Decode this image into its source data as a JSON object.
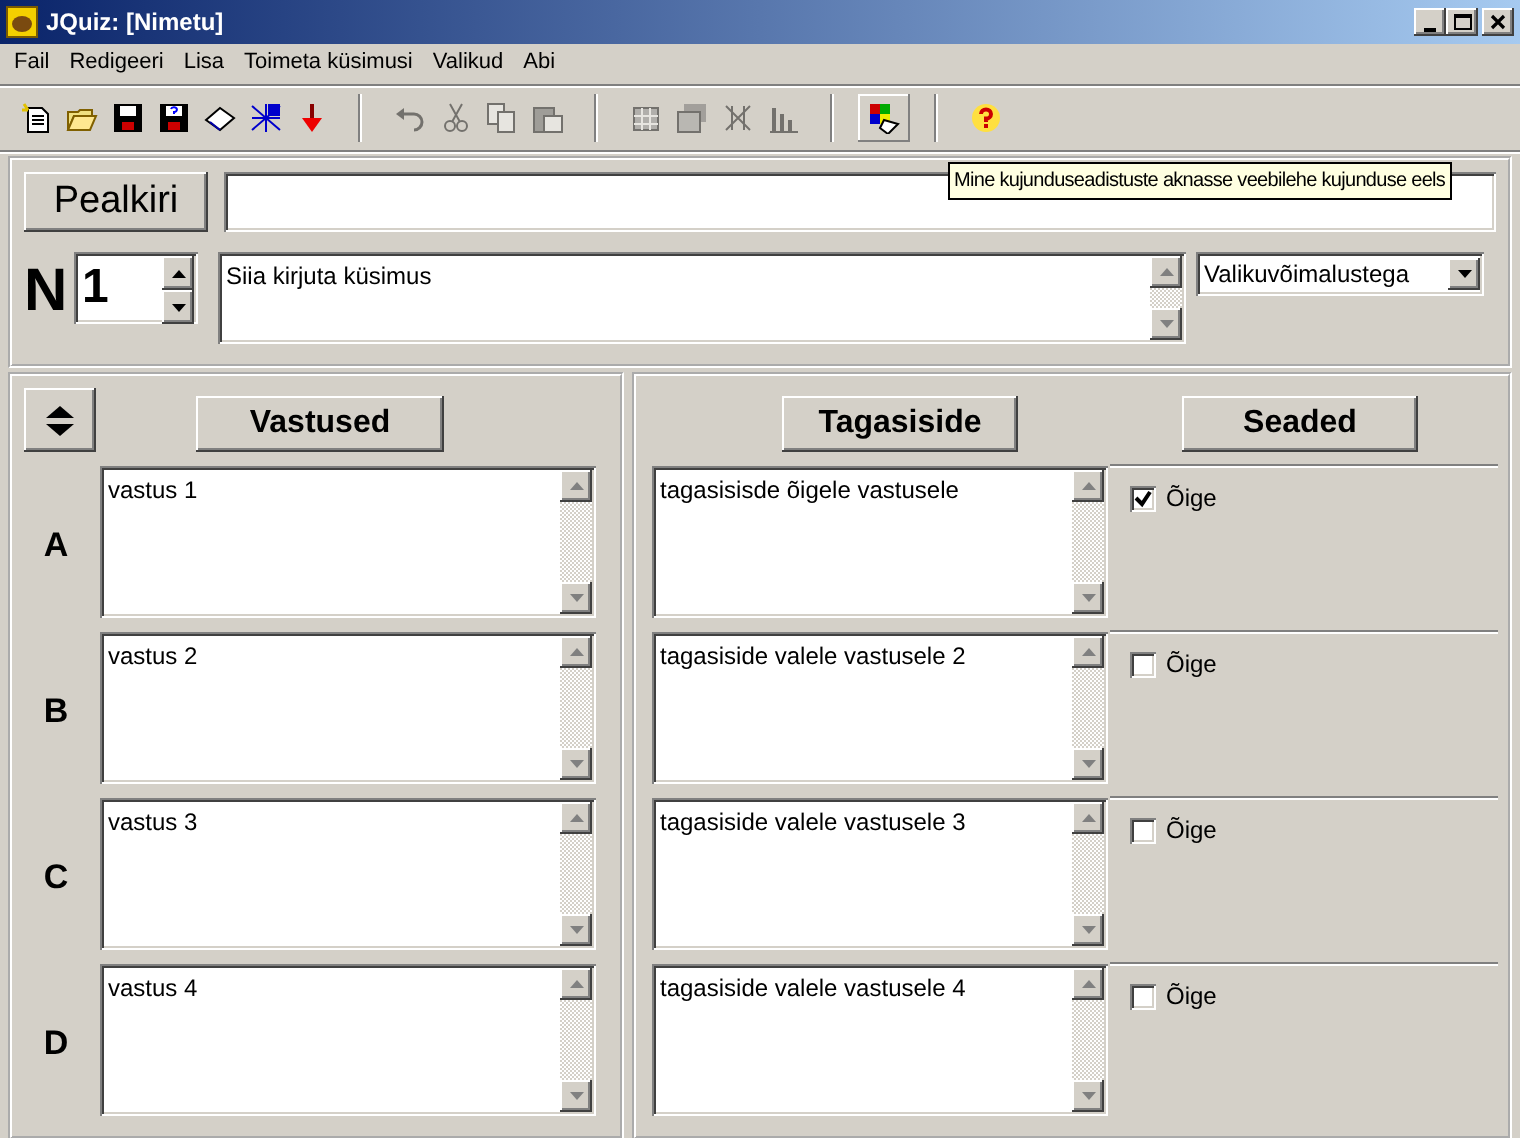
{
  "window": {
    "title": "JQuiz: [Nimetu]"
  },
  "menu": [
    "Fail",
    "Redigeeri",
    "Lisa",
    "Toimeta küsimusi",
    "Valikud",
    "Abi"
  ],
  "toolbar": [
    {
      "buttons": [
        {
          "disabled": false,
          "pressed": false
        },
        {
          "disabled": false,
          "pressed": false
        },
        {
          "disabled": false,
          "pressed": false
        },
        {
          "disabled": false,
          "pressed": false
        },
        {
          "disabled": false,
          "pressed": false
        },
        {
          "disabled": false,
          "pressed": false
        },
        {
          "disabled": false,
          "pressed": false
        }
      ]
    },
    {
      "buttons": [
        {
          "disabled": true,
          "pressed": false
        },
        {
          "disabled": true,
          "pressed": false
        },
        {
          "disabled": true,
          "pressed": false
        },
        {
          "disabled": true,
          "pressed": false
        }
      ]
    },
    {
      "buttons": [
        {
          "disabled": true,
          "pressed": false
        },
        {
          "disabled": true,
          "pressed": false
        },
        {
          "disabled": true,
          "pressed": false
        },
        {
          "disabled": true,
          "pressed": false
        }
      ]
    },
    {
      "buttons": [
        {
          "disabled": false,
          "pressed": true
        }
      ]
    },
    {
      "buttons": [
        {
          "disabled": false,
          "pressed": false
        }
      ]
    }
  ],
  "tooltip": "Mine kujunduseadistuste aknasse veebilehe kujunduse eels",
  "title_button": "Pealkiri",
  "question": {
    "number_label": "N",
    "number": "1",
    "text": "Siia kirjuta küsimus",
    "type": "Valikuvõimalustega"
  },
  "columns": {
    "answers": "Vastused",
    "feedback": "Tagasiside",
    "settings": "Seaded"
  },
  "answers": [
    {
      "letter": "A",
      "answer": "vastus 1",
      "feedback": "tagasisisde õigele vastusele",
      "correct_label": "Õige",
      "checked": true
    },
    {
      "letter": "B",
      "answer": "vastus 2",
      "feedback": "tagasiside valele vastusele 2",
      "correct_label": "Õige",
      "checked": false
    },
    {
      "letter": "C",
      "answer": "vastus 3",
      "feedback": "tagasiside valele vastusele 3",
      "correct_label": "Õige",
      "checked": false
    },
    {
      "letter": "D",
      "answer": "vastus 4",
      "feedback": "tagasiside valele vastusele 4",
      "correct_label": "Õige",
      "checked": false
    }
  ]
}
